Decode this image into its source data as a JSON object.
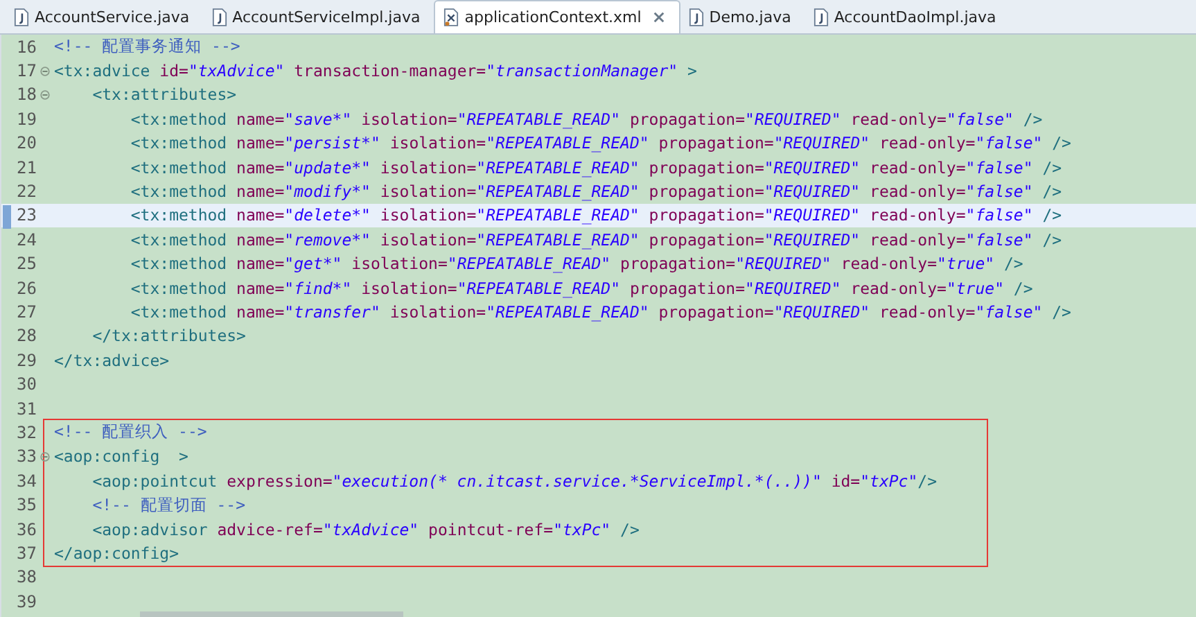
{
  "tabs": [
    {
      "label": "AccountService.java",
      "kind": "java",
      "selected": false
    },
    {
      "label": "AccountServiceImpl.java",
      "kind": "java",
      "selected": false
    },
    {
      "label": "applicationContext.xml",
      "kind": "xml",
      "selected": true
    },
    {
      "label": "Demo.java",
      "kind": "java",
      "selected": false
    },
    {
      "label": "AccountDaoImpl.java",
      "kind": "java",
      "selected": false
    }
  ],
  "editor": {
    "sections": [
      {
        "boxed": false,
        "lines": [
          {
            "number": "16",
            "current": false,
            "fold": false,
            "tokens": [
              {
                "kind": "comment",
                "text": "<!-- 配置事务通知 -->"
              }
            ]
          },
          {
            "number": "17",
            "current": false,
            "fold": true,
            "tokens": [
              {
                "kind": "tag",
                "text": "<tx:advice"
              },
              {
                "kind": "attr",
                "text": " id="
              },
              {
                "kind": "value",
                "text": "\"txAdvice\""
              },
              {
                "kind": "attr",
                "text": " transaction-manager="
              },
              {
                "kind": "value",
                "text": "\"transactionManager\""
              },
              {
                "kind": "tag",
                "text": " >"
              }
            ],
            "children": [
              {
                "number": "18",
                "current": false,
                "fold": true,
                "tokens": [
                  {
                    "kind": "tag",
                    "text": "<tx:attributes>"
                  }
                ],
                "children": [
                  {
                    "number": "19",
                    "current": false,
                    "fold": false,
                    "tokens": [
                      {
                        "kind": "tag",
                        "text": "<tx:method"
                      },
                      {
                        "kind": "attr",
                        "text": " name="
                      },
                      {
                        "kind": "value",
                        "text": "\"save*\""
                      },
                      {
                        "kind": "attr",
                        "text": " isolation="
                      },
                      {
                        "kind": "value",
                        "text": "\"REPEATABLE_READ\""
                      },
                      {
                        "kind": "attr",
                        "text": " propagation="
                      },
                      {
                        "kind": "value",
                        "text": "\"REQUIRED\""
                      },
                      {
                        "kind": "attr",
                        "text": " read-only="
                      },
                      {
                        "kind": "value",
                        "text": "\"false\""
                      },
                      {
                        "kind": "tag",
                        "text": " />"
                      }
                    ]
                  },
                  {
                    "number": "20",
                    "current": false,
                    "fold": false,
                    "tokens": [
                      {
                        "kind": "tag",
                        "text": "<tx:method"
                      },
                      {
                        "kind": "attr",
                        "text": " name="
                      },
                      {
                        "kind": "value",
                        "text": "\"persist*\""
                      },
                      {
                        "kind": "attr",
                        "text": " isolation="
                      },
                      {
                        "kind": "value",
                        "text": "\"REPEATABLE_READ\""
                      },
                      {
                        "kind": "attr",
                        "text": " propagation="
                      },
                      {
                        "kind": "value",
                        "text": "\"REQUIRED\""
                      },
                      {
                        "kind": "attr",
                        "text": " read-only="
                      },
                      {
                        "kind": "value",
                        "text": "\"false\""
                      },
                      {
                        "kind": "tag",
                        "text": " />"
                      }
                    ]
                  },
                  {
                    "number": "21",
                    "current": false,
                    "fold": false,
                    "tokens": [
                      {
                        "kind": "tag",
                        "text": "<tx:method"
                      },
                      {
                        "kind": "attr",
                        "text": " name="
                      },
                      {
                        "kind": "value",
                        "text": "\"update*\""
                      },
                      {
                        "kind": "attr",
                        "text": " isolation="
                      },
                      {
                        "kind": "value",
                        "text": "\"REPEATABLE_READ\""
                      },
                      {
                        "kind": "attr",
                        "text": " propagation="
                      },
                      {
                        "kind": "value",
                        "text": "\"REQUIRED\""
                      },
                      {
                        "kind": "attr",
                        "text": " read-only="
                      },
                      {
                        "kind": "value",
                        "text": "\"false\""
                      },
                      {
                        "kind": "tag",
                        "text": " />"
                      }
                    ]
                  },
                  {
                    "number": "22",
                    "current": false,
                    "fold": false,
                    "tokens": [
                      {
                        "kind": "tag",
                        "text": "<tx:method"
                      },
                      {
                        "kind": "attr",
                        "text": " name="
                      },
                      {
                        "kind": "value",
                        "text": "\"modify*\""
                      },
                      {
                        "kind": "attr",
                        "text": " isolation="
                      },
                      {
                        "kind": "value",
                        "text": "\"REPEATABLE_READ\""
                      },
                      {
                        "kind": "attr",
                        "text": " propagation="
                      },
                      {
                        "kind": "value",
                        "text": "\"REQUIRED\""
                      },
                      {
                        "kind": "attr",
                        "text": " read-only="
                      },
                      {
                        "kind": "value",
                        "text": "\"false\""
                      },
                      {
                        "kind": "tag",
                        "text": " />"
                      }
                    ]
                  },
                  {
                    "number": "23",
                    "current": true,
                    "fold": false,
                    "tokens": [
                      {
                        "kind": "tag",
                        "text": "<tx:method"
                      },
                      {
                        "kind": "attr",
                        "text": " name="
                      },
                      {
                        "kind": "value",
                        "text": "\"delete*\""
                      },
                      {
                        "kind": "attr",
                        "text": " isolation="
                      },
                      {
                        "kind": "value",
                        "text": "\"REPEATABLE_READ\""
                      },
                      {
                        "kind": "attr",
                        "text": " propagation="
                      },
                      {
                        "kind": "value",
                        "text": "\"REQUIRED\""
                      },
                      {
                        "kind": "attr",
                        "text": " read-only="
                      },
                      {
                        "kind": "value",
                        "text": "\"false\""
                      },
                      {
                        "kind": "tag",
                        "text": " />"
                      }
                    ]
                  },
                  {
                    "number": "24",
                    "current": false,
                    "fold": false,
                    "tokens": [
                      {
                        "kind": "tag",
                        "text": "<tx:method"
                      },
                      {
                        "kind": "attr",
                        "text": " name="
                      },
                      {
                        "kind": "value",
                        "text": "\"remove*\""
                      },
                      {
                        "kind": "attr",
                        "text": " isolation="
                      },
                      {
                        "kind": "value",
                        "text": "\"REPEATABLE_READ\""
                      },
                      {
                        "kind": "attr",
                        "text": " propagation="
                      },
                      {
                        "kind": "value",
                        "text": "\"REQUIRED\""
                      },
                      {
                        "kind": "attr",
                        "text": " read-only="
                      },
                      {
                        "kind": "value",
                        "text": "\"false\""
                      },
                      {
                        "kind": "tag",
                        "text": " />"
                      }
                    ]
                  },
                  {
                    "number": "25",
                    "current": false,
                    "fold": false,
                    "tokens": [
                      {
                        "kind": "tag",
                        "text": "<tx:method"
                      },
                      {
                        "kind": "attr",
                        "text": " name="
                      },
                      {
                        "kind": "value",
                        "text": "\"get*\""
                      },
                      {
                        "kind": "attr",
                        "text": " isolation="
                      },
                      {
                        "kind": "value",
                        "text": "\"REPEATABLE_READ\""
                      },
                      {
                        "kind": "attr",
                        "text": " propagation="
                      },
                      {
                        "kind": "value",
                        "text": "\"REQUIRED\""
                      },
                      {
                        "kind": "attr",
                        "text": " read-only="
                      },
                      {
                        "kind": "value",
                        "text": "\"true\""
                      },
                      {
                        "kind": "tag",
                        "text": " />"
                      }
                    ]
                  },
                  {
                    "number": "26",
                    "current": false,
                    "fold": false,
                    "tokens": [
                      {
                        "kind": "tag",
                        "text": "<tx:method"
                      },
                      {
                        "kind": "attr",
                        "text": " name="
                      },
                      {
                        "kind": "value",
                        "text": "\"find*\""
                      },
                      {
                        "kind": "attr",
                        "text": " isolation="
                      },
                      {
                        "kind": "value",
                        "text": "\"REPEATABLE_READ\""
                      },
                      {
                        "kind": "attr",
                        "text": " propagation="
                      },
                      {
                        "kind": "value",
                        "text": "\"REQUIRED\""
                      },
                      {
                        "kind": "attr",
                        "text": " read-only="
                      },
                      {
                        "kind": "value",
                        "text": "\"true\""
                      },
                      {
                        "kind": "tag",
                        "text": " />"
                      }
                    ]
                  },
                  {
                    "number": "27",
                    "current": false,
                    "fold": false,
                    "tokens": [
                      {
                        "kind": "tag",
                        "text": "<tx:method"
                      },
                      {
                        "kind": "attr",
                        "text": " name="
                      },
                      {
                        "kind": "value",
                        "text": "\"transfer\""
                      },
                      {
                        "kind": "attr",
                        "text": " isolation="
                      },
                      {
                        "kind": "value",
                        "text": "\"REPEATABLE_READ\""
                      },
                      {
                        "kind": "attr",
                        "text": " propagation="
                      },
                      {
                        "kind": "value",
                        "text": "\"REQUIRED\""
                      },
                      {
                        "kind": "attr",
                        "text": " read-only="
                      },
                      {
                        "kind": "value",
                        "text": "\"false\""
                      },
                      {
                        "kind": "tag",
                        "text": " />"
                      }
                    ]
                  }
                ]
              },
              {
                "number": "28",
                "current": false,
                "fold": false,
                "tokens": [
                  {
                    "kind": "tag",
                    "text": "</tx:attributes>"
                  }
                ]
              }
            ]
          },
          {
            "number": "29",
            "current": false,
            "fold": false,
            "tokens": [
              {
                "kind": "tag",
                "text": "</tx:advice>"
              }
            ]
          },
          {
            "number": "30",
            "current": false,
            "fold": false
          },
          {
            "number": "31",
            "current": false,
            "fold": false
          }
        ]
      },
      {
        "boxed": true,
        "lines": [
          {
            "number": "32",
            "current": false,
            "fold": false,
            "tokens": [
              {
                "kind": "comment",
                "text": "<!-- 配置织入 -->"
              }
            ]
          },
          {
            "number": "33",
            "current": false,
            "fold": true,
            "tokens": [
              {
                "kind": "tag",
                "text": "<aop:config  >"
              }
            ],
            "children": [
              {
                "number": "34",
                "current": false,
                "fold": false,
                "tokens": [
                  {
                    "kind": "tag",
                    "text": "<aop:pointcut"
                  },
                  {
                    "kind": "attr",
                    "text": " expression="
                  },
                  {
                    "kind": "value",
                    "text": "\"execution(* cn.itcast.service.*ServiceImpl.*(..))\""
                  },
                  {
                    "kind": "attr",
                    "text": " id="
                  },
                  {
                    "kind": "value",
                    "text": "\"txPc\""
                  },
                  {
                    "kind": "tag",
                    "text": "/>"
                  }
                ]
              },
              {
                "number": "35",
                "current": false,
                "fold": false,
                "tokens": [
                  {
                    "kind": "comment",
                    "text": "<!-- 配置切面 -->"
                  }
                ]
              },
              {
                "number": "36",
                "current": false,
                "fold": false,
                "tokens": [
                  {
                    "kind": "tag",
                    "text": "<aop:advisor"
                  },
                  {
                    "kind": "attr",
                    "text": " advice-ref="
                  },
                  {
                    "kind": "value",
                    "text": "\"txAdvice\""
                  },
                  {
                    "kind": "attr",
                    "text": " pointcut-ref="
                  },
                  {
                    "kind": "value",
                    "text": "\"txPc\""
                  },
                  {
                    "kind": "tag",
                    "text": " />"
                  }
                ]
              }
            ]
          },
          {
            "number": "37",
            "current": false,
            "fold": false,
            "tokens": [
              {
                "kind": "tag",
                "text": "</aop:config>"
              }
            ]
          }
        ]
      },
      {
        "boxed": false,
        "lines": [
          {
            "number": "38",
            "current": false,
            "fold": false
          },
          {
            "number": "39",
            "current": false,
            "fold": false
          }
        ]
      }
    ]
  }
}
